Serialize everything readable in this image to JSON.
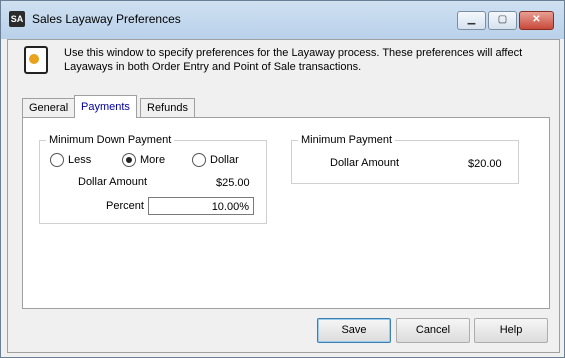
{
  "window": {
    "title": "Sales Layaway Preferences",
    "app_icon_text": "SA",
    "min_symbol": "▁",
    "max_symbol": "▢",
    "close_symbol": "✕"
  },
  "info": {
    "text": "Use this window to specify preferences for the Layaway process. These preferences will affect Layaways in both Order Entry and Point of Sale transactions."
  },
  "tabs": [
    {
      "label": "General"
    },
    {
      "label": "Payments",
      "active": true
    },
    {
      "label": "Refunds"
    }
  ],
  "min_down_payment": {
    "legend": "Minimum Down Payment",
    "options": [
      {
        "label": "Less",
        "selected": false
      },
      {
        "label": "More",
        "selected": true
      },
      {
        "label": "Dollar",
        "selected": false
      }
    ],
    "dollar_amount_label": "Dollar Amount",
    "dollar_amount_value": "$25.00",
    "percent_label": "Percent",
    "percent_value": "10.00%"
  },
  "min_payment": {
    "legend": "Minimum Payment",
    "dollar_amount_label": "Dollar Amount",
    "dollar_amount_value": "$20.00"
  },
  "buttons": {
    "save": "Save",
    "cancel": "Cancel",
    "help": "Help"
  }
}
